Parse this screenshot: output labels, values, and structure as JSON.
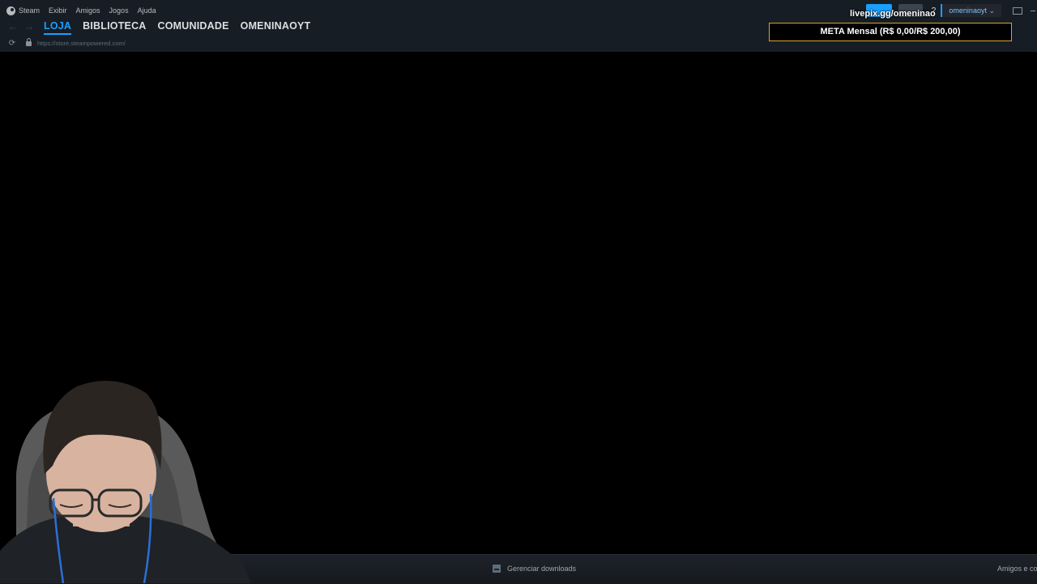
{
  "menu": {
    "app": "Steam",
    "items": [
      "Exibir",
      "Amigos",
      "Jogos",
      "Ajuda"
    ]
  },
  "nav": {
    "tabs": [
      "LOJA",
      "BIBLIOTECA",
      "COMUNIDADE",
      "OMENINAOYT"
    ],
    "active_tab": "LOJA"
  },
  "url": "https://store.steampowered.com/",
  "account": {
    "username": "omeninaoyt",
    "help": "?"
  },
  "overlay": {
    "livepix": "livepix.gg/omeninao",
    "meta": "META Mensal (R$ 0,00/R$ 200,00)"
  },
  "footer": {
    "downloads": "Gerenciar downloads",
    "friends": "Amigos e co"
  },
  "colors": {
    "accent": "#1a9fff",
    "header_bg": "#171d25",
    "meta_border": "#d4a72c"
  }
}
